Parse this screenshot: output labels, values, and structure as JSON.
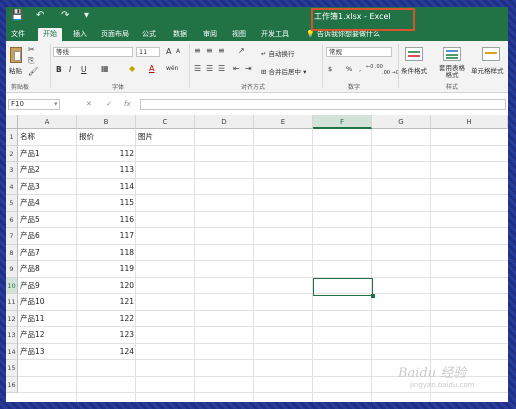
{
  "window": {
    "title": "工作簿1.xlsx - Excel",
    "qat": {
      "save": "💾",
      "undo": "↶",
      "redo": "↷",
      "customize": "▾"
    }
  },
  "tabs": [
    {
      "label": "文件",
      "active": false
    },
    {
      "label": "开始",
      "active": true
    },
    {
      "label": "插入",
      "active": false
    },
    {
      "label": "页面布局",
      "active": false
    },
    {
      "label": "公式",
      "active": false
    },
    {
      "label": "数据",
      "active": false
    },
    {
      "label": "审阅",
      "active": false
    },
    {
      "label": "视图",
      "active": false
    },
    {
      "label": "开发工具",
      "active": false
    }
  ],
  "tell_me": "告诉我你想要做什么",
  "ribbon": {
    "clipboard": {
      "paste_label": "粘贴",
      "group_label": "剪贴板"
    },
    "font": {
      "font_name": "等线",
      "font_size": "11",
      "bold": "B",
      "italic": "I",
      "underline": "U",
      "grow": "A",
      "shrink": "A",
      "font_color_glyph": "A",
      "phonetic": "wén",
      "group_label": "字体"
    },
    "alignment": {
      "wrap_text": "自动换行",
      "merge_center": "合并后居中",
      "group_label": "对齐方式"
    },
    "number": {
      "format": "常规",
      "currency": "$",
      "percent": "%",
      "comma": ",",
      "increase_decimal": "←0 .00",
      "decrease_decimal": ".00 →0",
      "group_label": "数字"
    },
    "styles": {
      "conditional": "条件格式",
      "format_table": "套用表格格式",
      "cell_styles": "单元格样式",
      "group_label": "样式"
    }
  },
  "formula_bar": {
    "name_box": "F10",
    "fx": "fx",
    "value": ""
  },
  "grid": {
    "columns": [
      "A",
      "B",
      "C",
      "D",
      "E",
      "F",
      "G",
      "H"
    ],
    "selected_column": "F",
    "selected_row": "10",
    "rows": [
      {
        "row": "1",
        "a": "名称",
        "b": "报价",
        "c": "图片"
      },
      {
        "row": "2",
        "a": "产品1",
        "b": "112",
        "c": ""
      },
      {
        "row": "3",
        "a": "产品2",
        "b": "113",
        "c": ""
      },
      {
        "row": "4",
        "a": "产品3",
        "b": "114",
        "c": ""
      },
      {
        "row": "5",
        "a": "产品4",
        "b": "115",
        "c": ""
      },
      {
        "row": "6",
        "a": "产品5",
        "b": "116",
        "c": ""
      },
      {
        "row": "7",
        "a": "产品6",
        "b": "117",
        "c": ""
      },
      {
        "row": "8",
        "a": "产品7",
        "b": "118",
        "c": ""
      },
      {
        "row": "9",
        "a": "产品8",
        "b": "119",
        "c": ""
      },
      {
        "row": "10",
        "a": "产品9",
        "b": "120",
        "c": ""
      },
      {
        "row": "11",
        "a": "产品10",
        "b": "121",
        "c": ""
      },
      {
        "row": "12",
        "a": "产品11",
        "b": "122",
        "c": ""
      },
      {
        "row": "13",
        "a": "产品12",
        "b": "123",
        "c": ""
      },
      {
        "row": "14",
        "a": "产品13",
        "b": "124",
        "c": ""
      },
      {
        "row": "15",
        "a": "",
        "b": "",
        "c": ""
      },
      {
        "row": "16",
        "a": "",
        "b": "",
        "c": ""
      }
    ]
  },
  "watermark": {
    "brand": "Baidu 经验",
    "url": "jingyan.baidu.com"
  },
  "colors": {
    "excel_green": "#217346",
    "highlight_box": "#d6552d"
  }
}
